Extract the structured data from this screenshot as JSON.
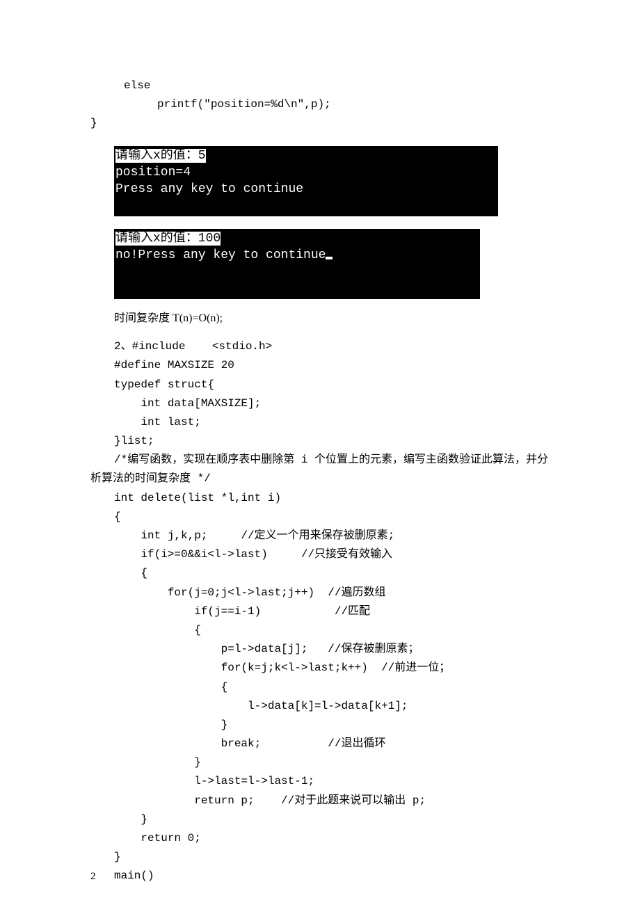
{
  "code_top": {
    "l1": "else",
    "l2": "printf(\"position=%d\\n\",p);",
    "l3": "}"
  },
  "terminal1": {
    "line1_hi": "请输入x的值：5",
    "line2": "position=4",
    "line3": "Press any key to continue"
  },
  "terminal2": {
    "line1_hi": "请输入x的值：100",
    "line2": "no!Press any key to continue"
  },
  "mid": {
    "complexity": "时间复杂度 T(n)=O(n);"
  },
  "code2": {
    "l1": "2、#include    <stdio.h>",
    "l2": "#define MAXSIZE 20",
    "l3": "typedef struct{",
    "l4": "    int data[MAXSIZE];",
    "l5": "    int last;",
    "l6": "}list;",
    "l7a": "/*编写函数，实现在顺序表中删除第 i 个位置上的元素，编写主函数验证此算法，并分",
    "l7b": "析算法的时间复杂度 */",
    "l8": "int delete(list *l,int i)",
    "l9": "{",
    "l10": "    int j,k,p;     //定义一个用来保存被删原素;",
    "l11": "    if(i>=0&&i<l->last)     //只接受有效输入",
    "l12": "    {",
    "l13": "        for(j=0;j<l->last;j++)  //遍历数组",
    "l14": "            if(j==i-1)           //匹配",
    "l15": "            {",
    "l16": "                p=l->data[j];   //保存被删原素；",
    "l17": "                for(k=j;k<l->last;k++)  //前进一位；",
    "l18": "                {",
    "l19": "                    l->data[k]=l->data[k+1];",
    "l20": "                }",
    "l21": "                break;          //退出循环",
    "l22": "            }",
    "l23": "            l->last=l->last-1;",
    "l24": "            return p;    //对于此题来说可以输出 p;",
    "l25": "    }",
    "l26": "    return 0;",
    "l27": "}",
    "l28": "main()"
  },
  "page_number": "2"
}
